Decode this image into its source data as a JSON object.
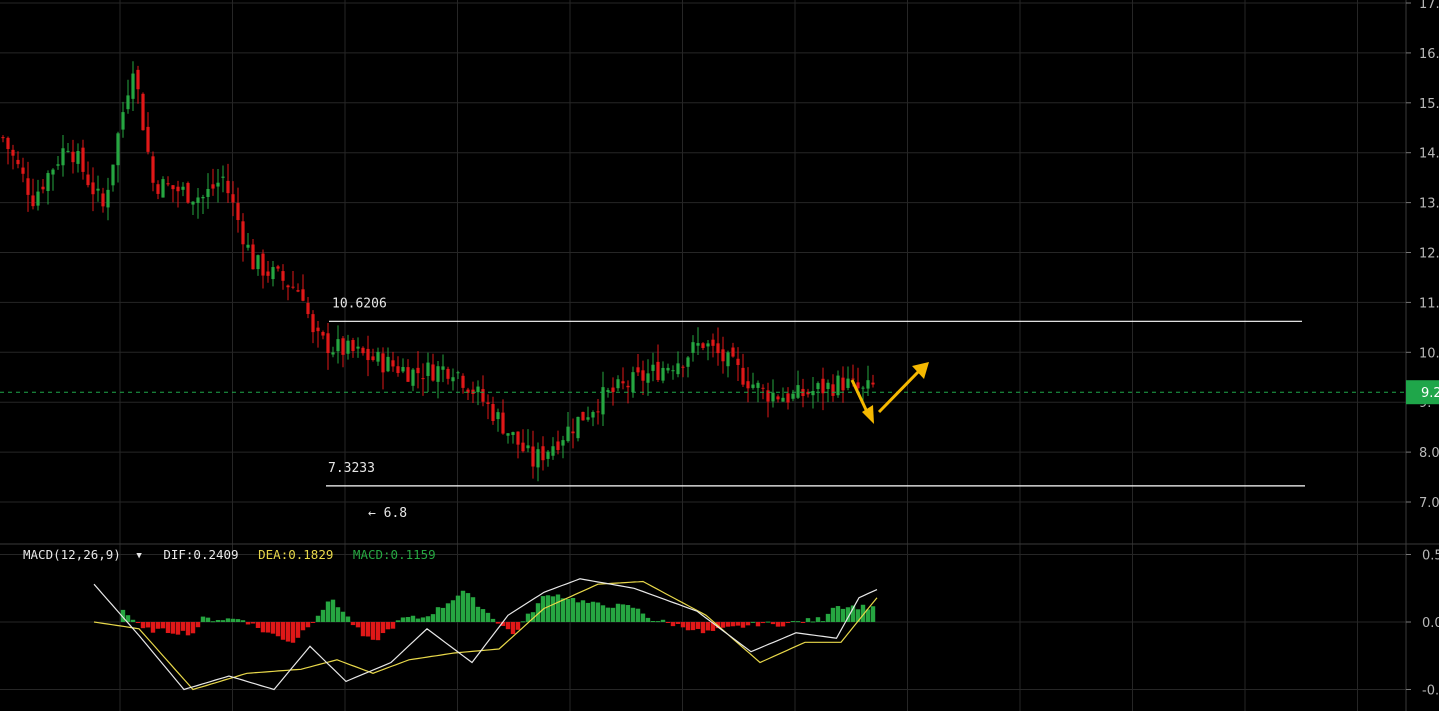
{
  "chart_data": [
    {
      "type": "candlestick",
      "ylim": [
        6.6,
        17.1
      ],
      "y_ticks": [
        {
          "value": 17,
          "label": "17."
        },
        {
          "value": 16,
          "label": "16."
        },
        {
          "value": 15,
          "label": "15."
        },
        {
          "value": 14,
          "label": "14."
        },
        {
          "value": 13,
          "label": "13."
        },
        {
          "value": 12,
          "label": "12."
        },
        {
          "value": 11,
          "label": "11."
        },
        {
          "value": 10,
          "label": "10."
        },
        {
          "value": 9,
          "label": "9."
        },
        {
          "value": 8,
          "label": "8.0"
        },
        {
          "value": 7,
          "label": "7.0"
        }
      ],
      "current_price": {
        "value": 9.2,
        "label": "9.2"
      },
      "levels": [
        {
          "value": 10.6206,
          "label": "10.6206"
        },
        {
          "value": 7.3233,
          "label": "7.3233"
        }
      ],
      "low_marker": {
        "value": 6.8,
        "label": "← 6.8"
      },
      "candle_count": 175,
      "close_path": [
        [
          0,
          14.3
        ],
        [
          6,
          13.1
        ],
        [
          13,
          14.2
        ],
        [
          20,
          12.9
        ],
        [
          26,
          15.8
        ],
        [
          30,
          13.4
        ],
        [
          40,
          13.1
        ],
        [
          44,
          13.5
        ],
        [
          50,
          11.8
        ],
        [
          60,
          11.2
        ],
        [
          62,
          10.3
        ],
        [
          66,
          10.1
        ],
        [
          70,
          10.0
        ],
        [
          82,
          9.6
        ],
        [
          90,
          9.7
        ],
        [
          98,
          8.8
        ],
        [
          106,
          7.8
        ],
        [
          120,
          9.1
        ],
        [
          136,
          9.9
        ],
        [
          140,
          10.2
        ],
        [
          152,
          9.2
        ],
        [
          158,
          9.1
        ],
        [
          168,
          9.4
        ],
        [
          172,
          9.2
        ],
        [
          174,
          9.3
        ]
      ],
      "colors": {
        "up": "#26a641",
        "down": "#e01818",
        "current": "#1fa64a",
        "level": "#ffffff",
        "arrow": "#f5b800"
      }
    },
    {
      "type": "macd",
      "indicator_label": "MACD(12,26,9)",
      "dif": {
        "label": "DIF:0.2409",
        "color": "#e8e8e8"
      },
      "dea": {
        "label": "DEA:0.1829",
        "color": "#e8d84a"
      },
      "macd": {
        "label": "MACD:0.1159",
        "color": "#26a641"
      },
      "ylim": [
        -0.56,
        0.56
      ],
      "y_ticks": [
        {
          "value": 0.5,
          "label": "0.5"
        },
        {
          "value": 0.0,
          "label": "0.0"
        },
        {
          "value": -0.5,
          "label": "-0."
        }
      ],
      "dif_path": [
        [
          0,
          0.28
        ],
        [
          10,
          -0.1
        ],
        [
          20,
          -0.5
        ],
        [
          30,
          -0.4
        ],
        [
          40,
          -0.5
        ],
        [
          48,
          -0.18
        ],
        [
          56,
          -0.44
        ],
        [
          66,
          -0.3
        ],
        [
          74,
          -0.05
        ],
        [
          84,
          -0.3
        ],
        [
          92,
          0.05
        ],
        [
          100,
          0.22
        ],
        [
          108,
          0.32
        ],
        [
          120,
          0.25
        ],
        [
          134,
          0.08
        ],
        [
          146,
          -0.22
        ],
        [
          156,
          -0.08
        ],
        [
          165,
          -0.12
        ],
        [
          170,
          0.18
        ],
        [
          174,
          0.24
        ]
      ],
      "dea_path": [
        [
          0,
          0.0
        ],
        [
          10,
          -0.05
        ],
        [
          22,
          -0.5
        ],
        [
          34,
          -0.38
        ],
        [
          46,
          -0.35
        ],
        [
          54,
          -0.28
        ],
        [
          62,
          -0.38
        ],
        [
          70,
          -0.28
        ],
        [
          80,
          -0.23
        ],
        [
          90,
          -0.2
        ],
        [
          100,
          0.1
        ],
        [
          112,
          0.28
        ],
        [
          122,
          0.3
        ],
        [
          136,
          0.05
        ],
        [
          148,
          -0.3
        ],
        [
          158,
          -0.15
        ],
        [
          166,
          -0.15
        ],
        [
          174,
          0.18
        ]
      ]
    }
  ]
}
